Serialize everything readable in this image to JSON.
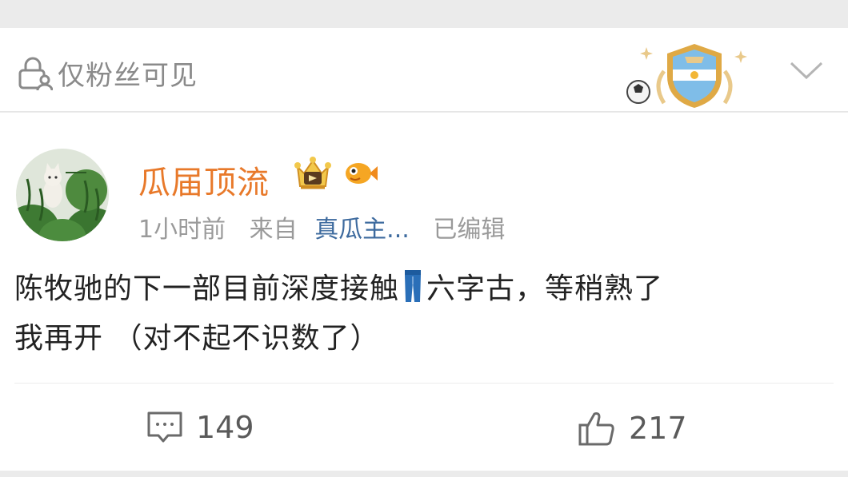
{
  "visibility": {
    "label": "仅粉丝可见",
    "icon": "lock-user-icon"
  },
  "header_badges": {
    "badge": "argentina-football-badge-icon",
    "expand_icon": "chevron-down-icon"
  },
  "post": {
    "author": {
      "name": "瓜届顶流",
      "name_color": "#e8792a",
      "avatar": "cat-watermelon-avatar"
    },
    "author_badges": [
      "crown-vip-icon",
      "fish-icon"
    ],
    "meta": {
      "time": "1小时前",
      "source_label": "来自",
      "source": "真瓜主...",
      "edited": "已编辑"
    },
    "content": {
      "line1_before_icon": "陈牧驰的下一部目前深度接触",
      "inline_icon": "jeans-emoji-icon",
      "line1_after_icon": "六字古，等稍熟了",
      "line2": "我再开 （对不起不识数了）"
    },
    "actions": {
      "comment_count": "149",
      "like_count": "217"
    }
  }
}
